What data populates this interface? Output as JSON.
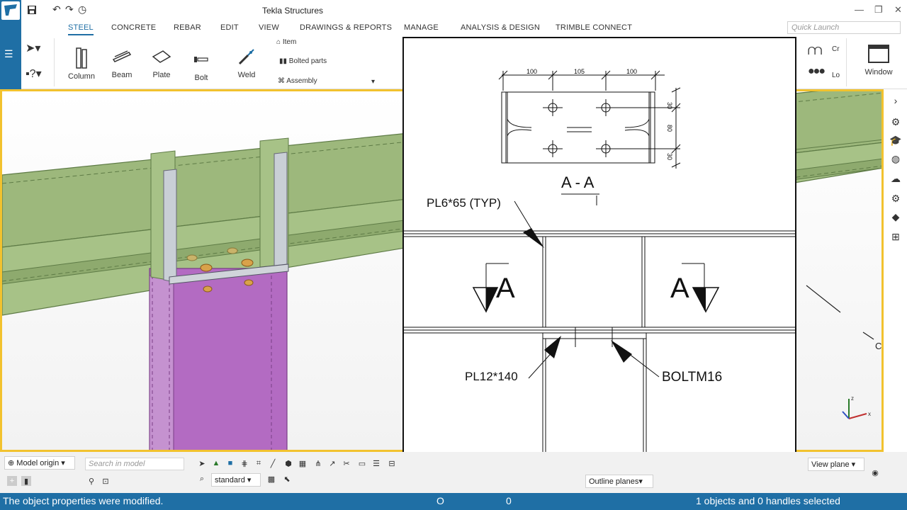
{
  "window": {
    "title": "Tekla Structures"
  },
  "ribbon_tabs": [
    {
      "label": "STEEL",
      "active": true
    },
    {
      "label": "CONCRETE"
    },
    {
      "label": "REBAR"
    },
    {
      "label": "EDIT"
    },
    {
      "label": "VIEW"
    },
    {
      "label": "DRAWINGS & REPORTS"
    },
    {
      "label": "MANAGE"
    },
    {
      "label": "ANALYSIS & DESIGN"
    },
    {
      "label": "TRIMBLE CONNECT"
    }
  ],
  "quick_launch": {
    "placeholder": "Quick Launch"
  },
  "ribbon": {
    "column": "Column",
    "beam": "Beam",
    "plate": "Plate",
    "bolt": "Bolt",
    "weld": "Weld",
    "item": "Item",
    "bolted_parts": "Bolted parts",
    "assembly": "Assembly",
    "cr": "Cr",
    "lo": "Lo",
    "window": "Window"
  },
  "drawing": {
    "dims_top": [
      "100",
      "105",
      "100"
    ],
    "dims_right": [
      "30",
      "80",
      "30"
    ],
    "section_label": "A - A",
    "section_marks": [
      "A",
      "A"
    ],
    "callouts": {
      "pl6": "PL6*65  (TYP)",
      "pl12": "PL12*140",
      "bolt": "BOLTM16"
    }
  },
  "bottom": {
    "model_origin": "Model origin",
    "search_placeholder": "Search in model",
    "standard": "standard",
    "outline_planes": "Outline planes",
    "view_plane": "View plane"
  },
  "status": {
    "message": "The object properties were modified.",
    "o": "O",
    "zero": "0",
    "selection": "1 objects and 0 handles selected"
  },
  "colors": {
    "accent": "#1f6fa5",
    "viewport_border": "#f2c22e",
    "beam_green": "#9db87c",
    "column_purple": "#b36bc2"
  }
}
